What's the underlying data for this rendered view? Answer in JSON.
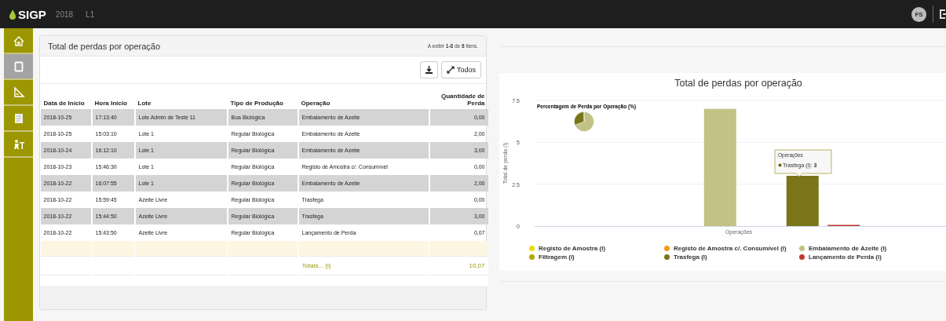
{
  "topbar": {
    "app_name": "SIGP",
    "year": "2018",
    "site": "L1",
    "user_initials": "FS"
  },
  "sidebar": {
    "items": [
      {
        "kind": "home",
        "selected": false
      },
      {
        "kind": "square",
        "selected": true
      },
      {
        "kind": "ruler",
        "selected": false
      },
      {
        "kind": "document",
        "selected": false
      },
      {
        "kind": "worker",
        "selected": false
      }
    ]
  },
  "table_panel": {
    "title": "Total de perdas por operação",
    "summary": "A exibir **1-8** de **8** itens.",
    "buttons": [
      {
        "kind": "export"
      },
      {
        "kind": "expand",
        "label": "Todos"
      }
    ],
    "columns": [
      "Data de Início",
      "Hora Início",
      "Lote",
      "Tipo de Produção",
      "Operação",
      "Quantidade de Perda"
    ],
    "rows": [
      [
        "2018-10-25",
        "17:13:40",
        "Lote Admin de Teste 11",
        "Boa Biológica",
        "Embalamento de Azeite",
        "0,00"
      ],
      [
        "2018-10-25",
        "15:03:10",
        "Lote 1",
        "Regular Biológica",
        "Embalamento de Azeite",
        "2,00"
      ],
      [
        "2018-10-24",
        "16:12:10",
        "Lote 1",
        "Regular Biológica",
        "Embalamento de Azeite",
        "3,00"
      ],
      [
        "2018-10-23",
        "15:46:30",
        "Lote 1",
        "Regular Biológica",
        "Registo de Amostra c/. Consumível",
        "0,00"
      ],
      [
        "2018-10-22",
        "16:07:55",
        "Lote 1",
        "Regular Biológica",
        "Embalamento de Azeite",
        "2,00"
      ],
      [
        "2018-10-22",
        "15:59:45",
        "Azeite Livre",
        "Regular Biológica",
        "Trasfega",
        "0,00"
      ],
      [
        "2018-10-22",
        "15:44:50",
        "Azeite Livre",
        "Regular Biológica",
        "Trasfega",
        "3,00"
      ],
      [
        "2018-10-22",
        "15:43:50",
        "Azeite Livre",
        "Regular Biológica",
        "Lançamento de Perda",
        "0,07"
      ]
    ],
    "totals": {
      "label": "Totais... (l)",
      "value": "10,07"
    }
  },
  "chart_panel": {
    "pie_title": "Percentagem de Perda por Operação (%)",
    "tooltip": {
      "title": "Operações",
      "label": "Trasfega (l): **3**",
      "color": "#6b6400"
    },
    "chart_data": {
      "type": "bar",
      "title": "Total de perdas por operação",
      "legend": "bottom",
      "ylabel": "Total de perda (l)",
      "categories": [
        "Operações"
      ],
      "ylim": [
        0,
        7.5
      ],
      "yticks": [
        0,
        2.5,
        5,
        7.5
      ],
      "series": [
        {
          "name": "Registo de Amostra (l)",
          "color": "#e8e000",
          "values": [
            0
          ]
        },
        {
          "name": "Registo de Amostra c/. Consumível (l)",
          "color": "#f39c12",
          "values": [
            0
          ]
        },
        {
          "name": "Embalamento de Azeite (l)",
          "color": "#c2c287",
          "values": [
            7
          ]
        },
        {
          "name": "Filtragem (l)",
          "color": "#b5a800",
          "values": [
            0
          ]
        },
        {
          "name": "Trasfega (l)",
          "color": "#7a7519",
          "values": [
            3
          ]
        },
        {
          "name": "Lançamento de Perda (l)",
          "color": "#c0392b",
          "values": [
            0.07
          ]
        }
      ]
    }
  }
}
